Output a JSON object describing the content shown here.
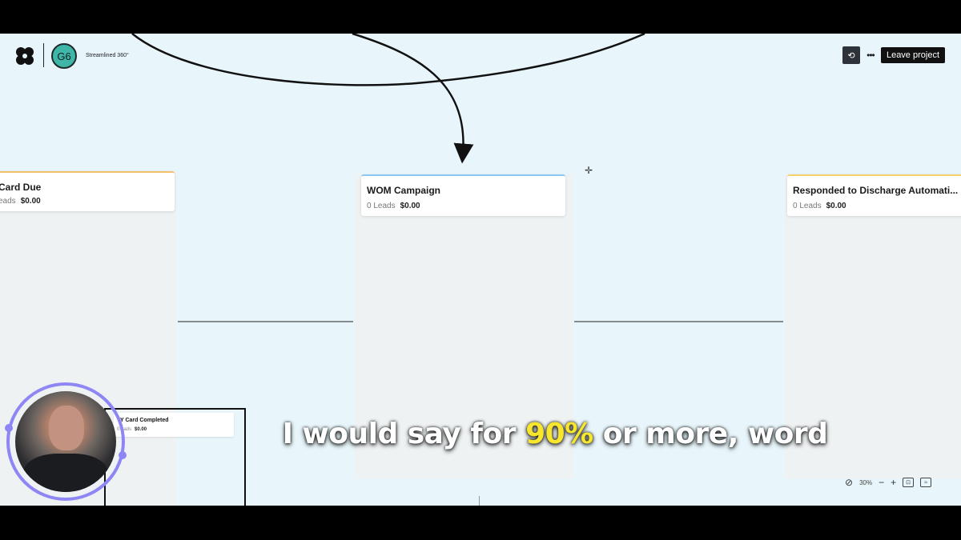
{
  "header": {
    "avatar_initials": "G6",
    "project_name": "Streamlined 360°",
    "leave_label": "Leave project",
    "more_icon": "ellipsis-icon",
    "history_icon": "history-icon"
  },
  "columns": [
    {
      "title": "Card Due",
      "leads": "eads",
      "amount": "$0.00",
      "accent": "#f3c16b"
    },
    {
      "title": "WOM Campaign",
      "leads": "0 Leads",
      "amount": "$0.00",
      "accent": "#8cc7f0"
    },
    {
      "title": "Responded to Discharge Automati...",
      "leads": "0 Leads",
      "amount": "$0.00",
      "accent": "#f3d26b"
    }
  ],
  "mini_card": {
    "title": "Y Card Completed",
    "leads": "0 eads",
    "amount": "$0.00"
  },
  "zoom": {
    "level": "30%",
    "minus": "−",
    "plus": "+"
  },
  "caption": {
    "before": "I would say for",
    "highlight": "90%",
    "after": "or more, word"
  },
  "colors": {
    "canvas": "#e8f6fb",
    "highlight": "#f7e62b",
    "ring": "#8f86f5",
    "avatar": "#3fb6a8"
  }
}
